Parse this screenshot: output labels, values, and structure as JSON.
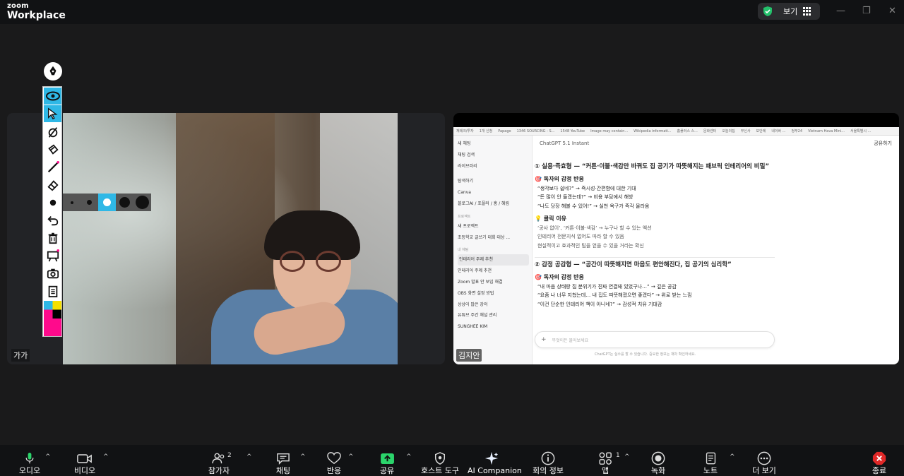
{
  "app": {
    "brand_top": "zoom",
    "brand_bottom": "Workplace"
  },
  "topbar": {
    "view_label": "보기"
  },
  "participants": {
    "left_name": "가가",
    "right_name": "김지안"
  },
  "shared_screen": {
    "bookmarks": [
      "재테크/투자",
      "1개 신청",
      "Papago",
      "1346 SOURCING - S...",
      "1548 YouTube",
      "Image may contain...",
      "Wikipedia informati...",
      "홈플러스 스...",
      "문화센터",
      "오늘의집",
      "무신사",
      "보안에",
      "네이버 ...",
      "정부24",
      "Vietnam Hava Mini...",
      "서울특별시 ..."
    ],
    "sidebar": {
      "top_items": [
        "새 채팅",
        "채팅 검색",
        "라이브러리"
      ],
      "tool_items": [
        "탐색하기",
        "Canva",
        "블로그AI / 포플러 / 홍 / 혜림"
      ],
      "projects_header": "프로젝트",
      "project_items": [
        "새 프로젝트",
        "초등학교 글쓰기 대회 대상 ..."
      ],
      "chats_header": "내 채팅",
      "chat_items": [
        "인테리어 주제 추천",
        "인테리어 주제 추천",
        "Zoom 발표 안 보임 해결",
        "OBS 화면 설정 방법",
        "상상이 많은 강의",
        "유튜브 주간 채널 관리",
        "SUNGHEE KIM"
      ]
    },
    "chat_header": {
      "model": "ChatGPT 5.1 Instant",
      "share": "공유하기"
    },
    "sections": [
      {
        "title": "① 실용·즉효형 — “커튼·이불·색감만 바꿔도 집 공기가 따뜻해지는 패브릭 인테리어의 비밀”",
        "sub1": "🎯 독자의 감정 반응",
        "bullets1": [
          "“생각보다 쉽네?” → 즉시성·간편함에 대한 기대",
          "“돈 많이 안 들겠는데?” → 비용 부담에서 해방",
          "“나도 당장 해볼 수 있어!” → 실천 욕구가 즉각 올라옴"
        ],
        "sub2": "💡 클릭 이유",
        "bullets2": [
          "‘공사 없이’, ‘커튼·이불·색감’ → 누구나 할 수 있는 액션",
          "인테리어 전문지식 없어도 따라 할 수 있음",
          "현실적이고 효과적인 팁을 얻을 수 있을 거라는 확신"
        ]
      },
      {
        "title": "② 감정 공감형 — “공간이 따뜻해지면 마음도 편안해진다, 집 공기의 심리학”",
        "sub1": "🎯 독자의 감정 반응",
        "bullets1": [
          "“내 마음 상태랑 집 분위기가 진짜 연결돼 있었구나…” → 깊은 공감",
          "“요즘 나 너무 지쳤는데… 내 집도 따뜻해졌으면 좋겠다” → 위로 받는 느낌",
          "“이건 단순한 인테리어 책이 아니네?” → 감성적 치유 기대감"
        ]
      }
    ],
    "input_placeholder": "무엇이든 물어보세요",
    "footnote": "ChatGPT는 실수를 할 수 있습니다. 중요한 정보는 재차 확인하세요."
  },
  "annotation_colors": [
    "#2fb8e6",
    "#f5e000",
    "#ff0a8c",
    "#000000"
  ],
  "bottombar": {
    "audio": "오디오",
    "video": "비디오",
    "participants": "참가자",
    "participants_count": "2",
    "chat": "채팅",
    "reactions": "반응",
    "share": "공유",
    "host_tools": "호스트 도구",
    "ai_companion": "AI Companion",
    "meeting_info": "회의 정보",
    "apps": "앱",
    "apps_count": "1",
    "record": "녹화",
    "notes": "노트",
    "more": "더 보기",
    "end": "종료"
  }
}
